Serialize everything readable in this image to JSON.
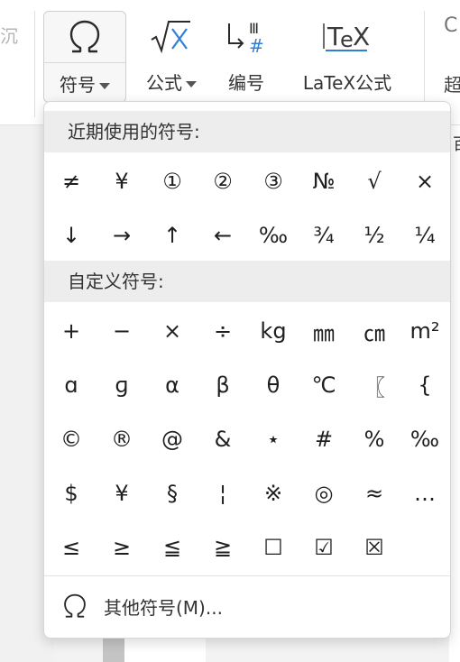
{
  "ribbon": {
    "left_cut_text": "沉",
    "right_cut_top": "C",
    "right_cut_label": "超",
    "symbol_btn": {
      "label": "符号",
      "icon": "omega-icon"
    },
    "formula_btn": {
      "label": "公式",
      "icon": "sqrt-x-icon"
    },
    "number_btn": {
      "label": "编号",
      "icon": "numbering-icon"
    },
    "latex_btn": {
      "label": "LaTeX公式",
      "icon": "tex-icon"
    }
  },
  "document": {
    "right_cut_char": "百"
  },
  "dropdown": {
    "recent_title": "近期使用的符号:",
    "recent_symbols": [
      "≠",
      "¥",
      "①",
      "②",
      "③",
      "№",
      "√",
      "×",
      "↓",
      "→",
      "↑",
      "←",
      "‰",
      "¾",
      "½",
      "¼"
    ],
    "custom_title": "自定义符号:",
    "custom_symbols": [
      "+",
      "−",
      "×",
      "÷",
      "kg",
      "㎜",
      "㎝",
      "m²",
      "ɑ",
      "ɡ",
      "α",
      "β",
      "θ",
      "℃",
      "〖",
      "{",
      "©",
      "®",
      "@",
      "&",
      "⋆",
      "#",
      "%",
      "‰",
      "$",
      "¥",
      "§",
      "¦",
      "※",
      "◎",
      "≈",
      "…",
      "≤",
      "≥",
      "≦",
      "≧",
      "☐",
      "☑",
      "☒"
    ],
    "more_label": "其他符号(M)...",
    "more_icon": "omega-icon"
  }
}
